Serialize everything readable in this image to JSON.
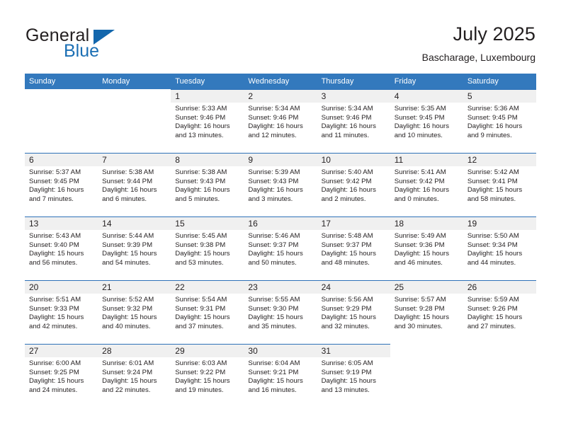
{
  "brand": {
    "name_top": "General",
    "name_bottom": "Blue",
    "triangle_color": "#1367ad",
    "blue_color": "#1b6fb4"
  },
  "header": {
    "title": "July 2025",
    "subtitle": "Bascharage, Luxembourg"
  },
  "theme": {
    "header_row_bg": "#3379bd",
    "daynum_band_bg": "#f0f0f0",
    "week_rule": "#2e71b8",
    "text": "#231f20"
  },
  "weekdays": [
    "Sunday",
    "Monday",
    "Tuesday",
    "Wednesday",
    "Thursday",
    "Friday",
    "Saturday"
  ],
  "weeks": [
    [
      {
        "day": "",
        "sunrise": "",
        "sunset": "",
        "daylight_a": "",
        "daylight_b": "",
        "empty": true
      },
      {
        "day": "",
        "sunrise": "",
        "sunset": "",
        "daylight_a": "",
        "daylight_b": "",
        "empty": true
      },
      {
        "day": "1",
        "sunrise": "Sunrise: 5:33 AM",
        "sunset": "Sunset: 9:46 PM",
        "daylight_a": "Daylight: 16 hours",
        "daylight_b": "and 13 minutes."
      },
      {
        "day": "2",
        "sunrise": "Sunrise: 5:34 AM",
        "sunset": "Sunset: 9:46 PM",
        "daylight_a": "Daylight: 16 hours",
        "daylight_b": "and 12 minutes."
      },
      {
        "day": "3",
        "sunrise": "Sunrise: 5:34 AM",
        "sunset": "Sunset: 9:46 PM",
        "daylight_a": "Daylight: 16 hours",
        "daylight_b": "and 11 minutes."
      },
      {
        "day": "4",
        "sunrise": "Sunrise: 5:35 AM",
        "sunset": "Sunset: 9:45 PM",
        "daylight_a": "Daylight: 16 hours",
        "daylight_b": "and 10 minutes."
      },
      {
        "day": "5",
        "sunrise": "Sunrise: 5:36 AM",
        "sunset": "Sunset: 9:45 PM",
        "daylight_a": "Daylight: 16 hours",
        "daylight_b": "and 9 minutes."
      }
    ],
    [
      {
        "day": "6",
        "sunrise": "Sunrise: 5:37 AM",
        "sunset": "Sunset: 9:45 PM",
        "daylight_a": "Daylight: 16 hours",
        "daylight_b": "and 7 minutes."
      },
      {
        "day": "7",
        "sunrise": "Sunrise: 5:38 AM",
        "sunset": "Sunset: 9:44 PM",
        "daylight_a": "Daylight: 16 hours",
        "daylight_b": "and 6 minutes."
      },
      {
        "day": "8",
        "sunrise": "Sunrise: 5:38 AM",
        "sunset": "Sunset: 9:43 PM",
        "daylight_a": "Daylight: 16 hours",
        "daylight_b": "and 5 minutes."
      },
      {
        "day": "9",
        "sunrise": "Sunrise: 5:39 AM",
        "sunset": "Sunset: 9:43 PM",
        "daylight_a": "Daylight: 16 hours",
        "daylight_b": "and 3 minutes."
      },
      {
        "day": "10",
        "sunrise": "Sunrise: 5:40 AM",
        "sunset": "Sunset: 9:42 PM",
        "daylight_a": "Daylight: 16 hours",
        "daylight_b": "and 2 minutes."
      },
      {
        "day": "11",
        "sunrise": "Sunrise: 5:41 AM",
        "sunset": "Sunset: 9:42 PM",
        "daylight_a": "Daylight: 16 hours",
        "daylight_b": "and 0 minutes."
      },
      {
        "day": "12",
        "sunrise": "Sunrise: 5:42 AM",
        "sunset": "Sunset: 9:41 PM",
        "daylight_a": "Daylight: 15 hours",
        "daylight_b": "and 58 minutes."
      }
    ],
    [
      {
        "day": "13",
        "sunrise": "Sunrise: 5:43 AM",
        "sunset": "Sunset: 9:40 PM",
        "daylight_a": "Daylight: 15 hours",
        "daylight_b": "and 56 minutes."
      },
      {
        "day": "14",
        "sunrise": "Sunrise: 5:44 AM",
        "sunset": "Sunset: 9:39 PM",
        "daylight_a": "Daylight: 15 hours",
        "daylight_b": "and 54 minutes."
      },
      {
        "day": "15",
        "sunrise": "Sunrise: 5:45 AM",
        "sunset": "Sunset: 9:38 PM",
        "daylight_a": "Daylight: 15 hours",
        "daylight_b": "and 53 minutes."
      },
      {
        "day": "16",
        "sunrise": "Sunrise: 5:46 AM",
        "sunset": "Sunset: 9:37 PM",
        "daylight_a": "Daylight: 15 hours",
        "daylight_b": "and 50 minutes."
      },
      {
        "day": "17",
        "sunrise": "Sunrise: 5:48 AM",
        "sunset": "Sunset: 9:37 PM",
        "daylight_a": "Daylight: 15 hours",
        "daylight_b": "and 48 minutes."
      },
      {
        "day": "18",
        "sunrise": "Sunrise: 5:49 AM",
        "sunset": "Sunset: 9:36 PM",
        "daylight_a": "Daylight: 15 hours",
        "daylight_b": "and 46 minutes."
      },
      {
        "day": "19",
        "sunrise": "Sunrise: 5:50 AM",
        "sunset": "Sunset: 9:34 PM",
        "daylight_a": "Daylight: 15 hours",
        "daylight_b": "and 44 minutes."
      }
    ],
    [
      {
        "day": "20",
        "sunrise": "Sunrise: 5:51 AM",
        "sunset": "Sunset: 9:33 PM",
        "daylight_a": "Daylight: 15 hours",
        "daylight_b": "and 42 minutes."
      },
      {
        "day": "21",
        "sunrise": "Sunrise: 5:52 AM",
        "sunset": "Sunset: 9:32 PM",
        "daylight_a": "Daylight: 15 hours",
        "daylight_b": "and 40 minutes."
      },
      {
        "day": "22",
        "sunrise": "Sunrise: 5:54 AM",
        "sunset": "Sunset: 9:31 PM",
        "daylight_a": "Daylight: 15 hours",
        "daylight_b": "and 37 minutes."
      },
      {
        "day": "23",
        "sunrise": "Sunrise: 5:55 AM",
        "sunset": "Sunset: 9:30 PM",
        "daylight_a": "Daylight: 15 hours",
        "daylight_b": "and 35 minutes."
      },
      {
        "day": "24",
        "sunrise": "Sunrise: 5:56 AM",
        "sunset": "Sunset: 9:29 PM",
        "daylight_a": "Daylight: 15 hours",
        "daylight_b": "and 32 minutes."
      },
      {
        "day": "25",
        "sunrise": "Sunrise: 5:57 AM",
        "sunset": "Sunset: 9:28 PM",
        "daylight_a": "Daylight: 15 hours",
        "daylight_b": "and 30 minutes."
      },
      {
        "day": "26",
        "sunrise": "Sunrise: 5:59 AM",
        "sunset": "Sunset: 9:26 PM",
        "daylight_a": "Daylight: 15 hours",
        "daylight_b": "and 27 minutes."
      }
    ],
    [
      {
        "day": "27",
        "sunrise": "Sunrise: 6:00 AM",
        "sunset": "Sunset: 9:25 PM",
        "daylight_a": "Daylight: 15 hours",
        "daylight_b": "and 24 minutes."
      },
      {
        "day": "28",
        "sunrise": "Sunrise: 6:01 AM",
        "sunset": "Sunset: 9:24 PM",
        "daylight_a": "Daylight: 15 hours",
        "daylight_b": "and 22 minutes."
      },
      {
        "day": "29",
        "sunrise": "Sunrise: 6:03 AM",
        "sunset": "Sunset: 9:22 PM",
        "daylight_a": "Daylight: 15 hours",
        "daylight_b": "and 19 minutes."
      },
      {
        "day": "30",
        "sunrise": "Sunrise: 6:04 AM",
        "sunset": "Sunset: 9:21 PM",
        "daylight_a": "Daylight: 15 hours",
        "daylight_b": "and 16 minutes."
      },
      {
        "day": "31",
        "sunrise": "Sunrise: 6:05 AM",
        "sunset": "Sunset: 9:19 PM",
        "daylight_a": "Daylight: 15 hours",
        "daylight_b": "and 13 minutes."
      },
      {
        "day": "",
        "sunrise": "",
        "sunset": "",
        "daylight_a": "",
        "daylight_b": "",
        "empty": true
      },
      {
        "day": "",
        "sunrise": "",
        "sunset": "",
        "daylight_a": "",
        "daylight_b": "",
        "empty": true
      }
    ]
  ]
}
